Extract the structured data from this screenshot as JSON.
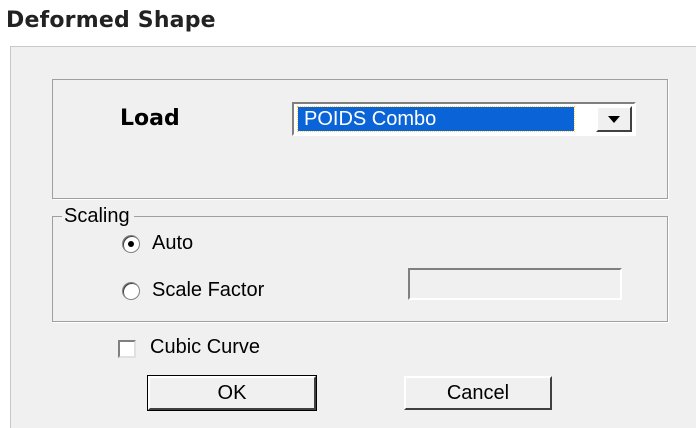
{
  "title": "Deformed Shape",
  "load": {
    "label": "Load",
    "selected": "POIDS Combo"
  },
  "scaling": {
    "group_label": "Scaling",
    "options": [
      {
        "label": "Auto",
        "selected": true
      },
      {
        "label": "Scale Factor",
        "selected": false
      }
    ],
    "scale_factor_value": ""
  },
  "cubic_curve": {
    "label": "Cubic Curve",
    "checked": false
  },
  "buttons": {
    "ok": "OK",
    "cancel": "Cancel"
  }
}
